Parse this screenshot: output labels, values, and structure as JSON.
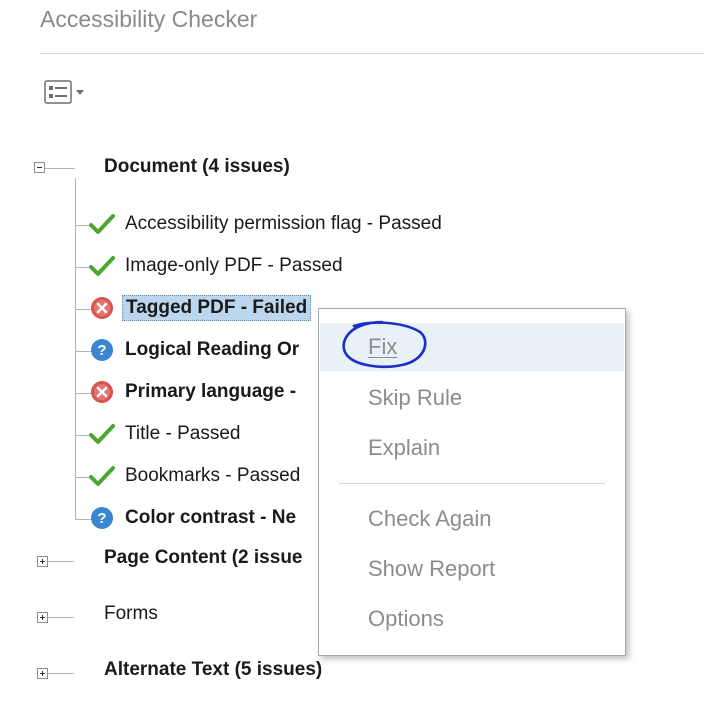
{
  "panel": {
    "title": "Accessibility Checker",
    "options_icon": "list-options-icon"
  },
  "tree": {
    "groups": [
      {
        "label": "Document (4 issues)",
        "expanded": true
      },
      {
        "label": "Page Content (2 issue",
        "expanded": false
      },
      {
        "label": "Forms",
        "expanded": false
      },
      {
        "label": "Alternate Text (5 issues)",
        "expanded": false
      }
    ],
    "document_items": [
      {
        "label": "Accessibility permission flag - Passed",
        "status": "passed",
        "icon": "check-icon"
      },
      {
        "label": "Image-only PDF - Passed",
        "status": "passed",
        "icon": "check-icon"
      },
      {
        "label": "Tagged PDF - Failed",
        "status": "failed",
        "icon": "error-icon",
        "selected": true
      },
      {
        "label": "Logical Reading Or",
        "status": "needs-check",
        "icon": "help-icon"
      },
      {
        "label": "Primary language -",
        "status": "failed",
        "icon": "error-icon"
      },
      {
        "label": "Title - Passed",
        "status": "passed",
        "icon": "check-icon"
      },
      {
        "label": "Bookmarks - Passed",
        "status": "passed",
        "icon": "check-icon"
      },
      {
        "label": "Color contrast - Ne",
        "status": "needs-check",
        "icon": "help-icon"
      }
    ]
  },
  "context_menu": {
    "items": [
      {
        "label": "Fix",
        "highlighted": true
      },
      {
        "label": "Skip Rule"
      },
      {
        "label": "Explain"
      },
      {
        "label": "Check Again"
      },
      {
        "label": "Show Report"
      },
      {
        "label": "Options"
      }
    ]
  },
  "colors": {
    "passed": "#4aa82f",
    "failed": "#d9534f",
    "needs_check": "#3b86d1",
    "selection": "#bcd6ee",
    "annotation": "#1a2fc9"
  }
}
